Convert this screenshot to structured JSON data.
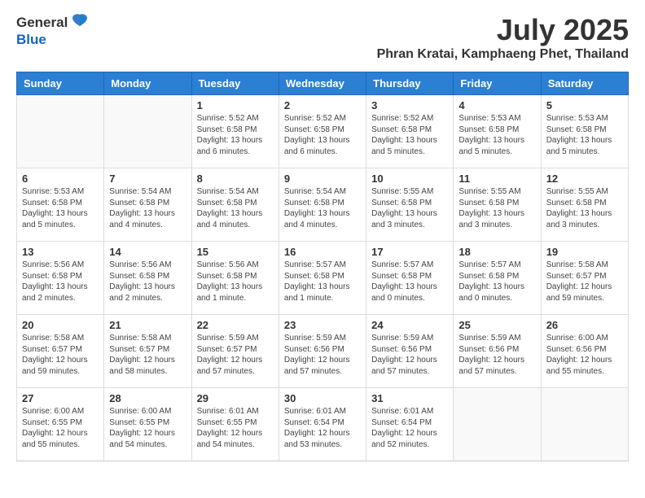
{
  "header": {
    "logo_general": "General",
    "logo_blue": "Blue",
    "month_title": "July 2025",
    "location": "Phran Kratai, Kamphaeng Phet, Thailand"
  },
  "weekdays": [
    "Sunday",
    "Monday",
    "Tuesday",
    "Wednesday",
    "Thursday",
    "Friday",
    "Saturday"
  ],
  "weeks": [
    [
      {
        "day": "",
        "info": ""
      },
      {
        "day": "",
        "info": ""
      },
      {
        "day": "1",
        "info": "Sunrise: 5:52 AM\nSunset: 6:58 PM\nDaylight: 13 hours\nand 6 minutes."
      },
      {
        "day": "2",
        "info": "Sunrise: 5:52 AM\nSunset: 6:58 PM\nDaylight: 13 hours\nand 6 minutes."
      },
      {
        "day": "3",
        "info": "Sunrise: 5:52 AM\nSunset: 6:58 PM\nDaylight: 13 hours\nand 5 minutes."
      },
      {
        "day": "4",
        "info": "Sunrise: 5:53 AM\nSunset: 6:58 PM\nDaylight: 13 hours\nand 5 minutes."
      },
      {
        "day": "5",
        "info": "Sunrise: 5:53 AM\nSunset: 6:58 PM\nDaylight: 13 hours\nand 5 minutes."
      }
    ],
    [
      {
        "day": "6",
        "info": "Sunrise: 5:53 AM\nSunset: 6:58 PM\nDaylight: 13 hours\nand 5 minutes."
      },
      {
        "day": "7",
        "info": "Sunrise: 5:54 AM\nSunset: 6:58 PM\nDaylight: 13 hours\nand 4 minutes."
      },
      {
        "day": "8",
        "info": "Sunrise: 5:54 AM\nSunset: 6:58 PM\nDaylight: 13 hours\nand 4 minutes."
      },
      {
        "day": "9",
        "info": "Sunrise: 5:54 AM\nSunset: 6:58 PM\nDaylight: 13 hours\nand 4 minutes."
      },
      {
        "day": "10",
        "info": "Sunrise: 5:55 AM\nSunset: 6:58 PM\nDaylight: 13 hours\nand 3 minutes."
      },
      {
        "day": "11",
        "info": "Sunrise: 5:55 AM\nSunset: 6:58 PM\nDaylight: 13 hours\nand 3 minutes."
      },
      {
        "day": "12",
        "info": "Sunrise: 5:55 AM\nSunset: 6:58 PM\nDaylight: 13 hours\nand 3 minutes."
      }
    ],
    [
      {
        "day": "13",
        "info": "Sunrise: 5:56 AM\nSunset: 6:58 PM\nDaylight: 13 hours\nand 2 minutes."
      },
      {
        "day": "14",
        "info": "Sunrise: 5:56 AM\nSunset: 6:58 PM\nDaylight: 13 hours\nand 2 minutes."
      },
      {
        "day": "15",
        "info": "Sunrise: 5:56 AM\nSunset: 6:58 PM\nDaylight: 13 hours\nand 1 minute."
      },
      {
        "day": "16",
        "info": "Sunrise: 5:57 AM\nSunset: 6:58 PM\nDaylight: 13 hours\nand 1 minute."
      },
      {
        "day": "17",
        "info": "Sunrise: 5:57 AM\nSunset: 6:58 PM\nDaylight: 13 hours\nand 0 minutes."
      },
      {
        "day": "18",
        "info": "Sunrise: 5:57 AM\nSunset: 6:58 PM\nDaylight: 13 hours\nand 0 minutes."
      },
      {
        "day": "19",
        "info": "Sunrise: 5:58 AM\nSunset: 6:57 PM\nDaylight: 12 hours\nand 59 minutes."
      }
    ],
    [
      {
        "day": "20",
        "info": "Sunrise: 5:58 AM\nSunset: 6:57 PM\nDaylight: 12 hours\nand 59 minutes."
      },
      {
        "day": "21",
        "info": "Sunrise: 5:58 AM\nSunset: 6:57 PM\nDaylight: 12 hours\nand 58 minutes."
      },
      {
        "day": "22",
        "info": "Sunrise: 5:59 AM\nSunset: 6:57 PM\nDaylight: 12 hours\nand 57 minutes."
      },
      {
        "day": "23",
        "info": "Sunrise: 5:59 AM\nSunset: 6:56 PM\nDaylight: 12 hours\nand 57 minutes."
      },
      {
        "day": "24",
        "info": "Sunrise: 5:59 AM\nSunset: 6:56 PM\nDaylight: 12 hours\nand 57 minutes."
      },
      {
        "day": "25",
        "info": "Sunrise: 5:59 AM\nSunset: 6:56 PM\nDaylight: 12 hours\nand 57 minutes."
      },
      {
        "day": "26",
        "info": "Sunrise: 6:00 AM\nSunset: 6:56 PM\nDaylight: 12 hours\nand 55 minutes."
      }
    ],
    [
      {
        "day": "27",
        "info": "Sunrise: 6:00 AM\nSunset: 6:55 PM\nDaylight: 12 hours\nand 55 minutes."
      },
      {
        "day": "28",
        "info": "Sunrise: 6:00 AM\nSunset: 6:55 PM\nDaylight: 12 hours\nand 54 minutes."
      },
      {
        "day": "29",
        "info": "Sunrise: 6:01 AM\nSunset: 6:55 PM\nDaylight: 12 hours\nand 54 minutes."
      },
      {
        "day": "30",
        "info": "Sunrise: 6:01 AM\nSunset: 6:54 PM\nDaylight: 12 hours\nand 53 minutes."
      },
      {
        "day": "31",
        "info": "Sunrise: 6:01 AM\nSunset: 6:54 PM\nDaylight: 12 hours\nand 52 minutes."
      },
      {
        "day": "",
        "info": ""
      },
      {
        "day": "",
        "info": ""
      }
    ]
  ]
}
